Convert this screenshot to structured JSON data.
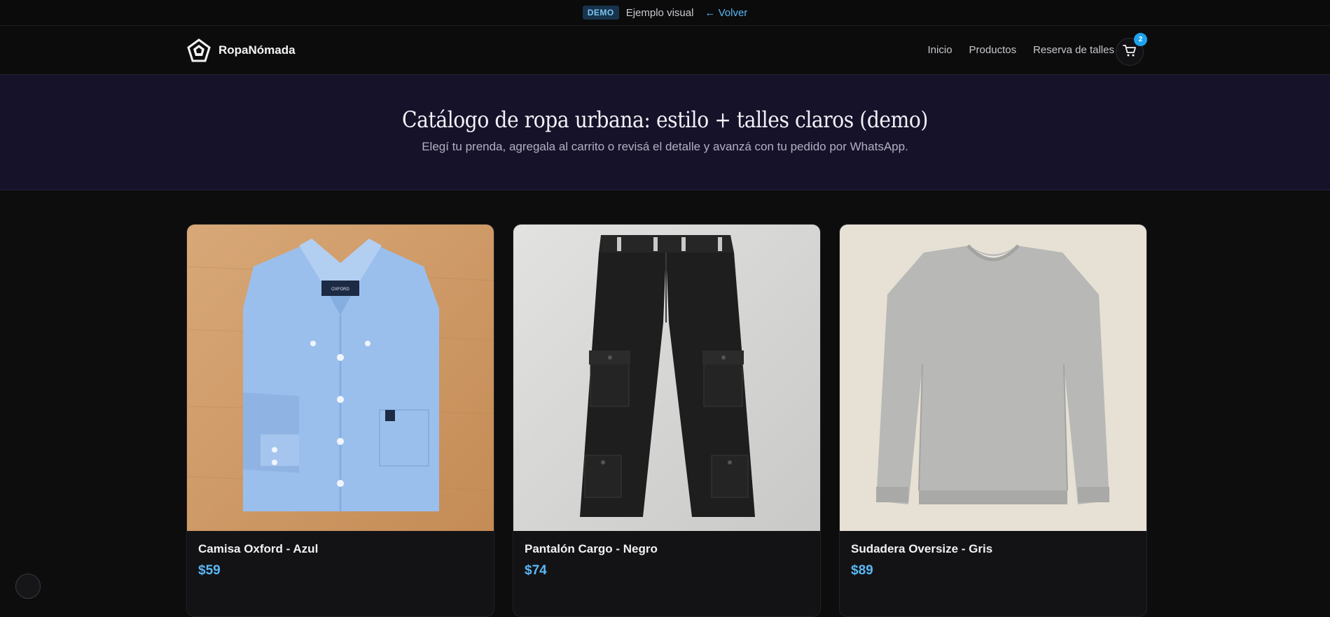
{
  "demo_bar": {
    "badge": "DEMO",
    "text": "Ejemplo visual",
    "back_link": "← Volver"
  },
  "header": {
    "brand_name": "RopaNómada",
    "nav": [
      "Inicio",
      "Productos",
      "Reserva de talles"
    ],
    "cart_count": "2"
  },
  "hero": {
    "title": "Catálogo de ropa urbana: estilo + talles claros (demo)",
    "subtitle": "Elegí tu prenda, agregala al carrito o revisá el detalle y avanzá con tu pedido por WhatsApp."
  },
  "products": [
    {
      "name": "Camisa Oxford - Azul",
      "price": "$59",
      "image_label": "OXFORD COLLECTION"
    },
    {
      "name": "Pantalón Cargo - Negro",
      "price": "$74"
    },
    {
      "name": "Sudadera Oversize - Gris",
      "price": "$89"
    }
  ],
  "colors": {
    "accent": "#1ea3ec",
    "price": "#5ab8f4",
    "hero_bg": "#15122a",
    "page_bg": "#0d0d0e"
  }
}
